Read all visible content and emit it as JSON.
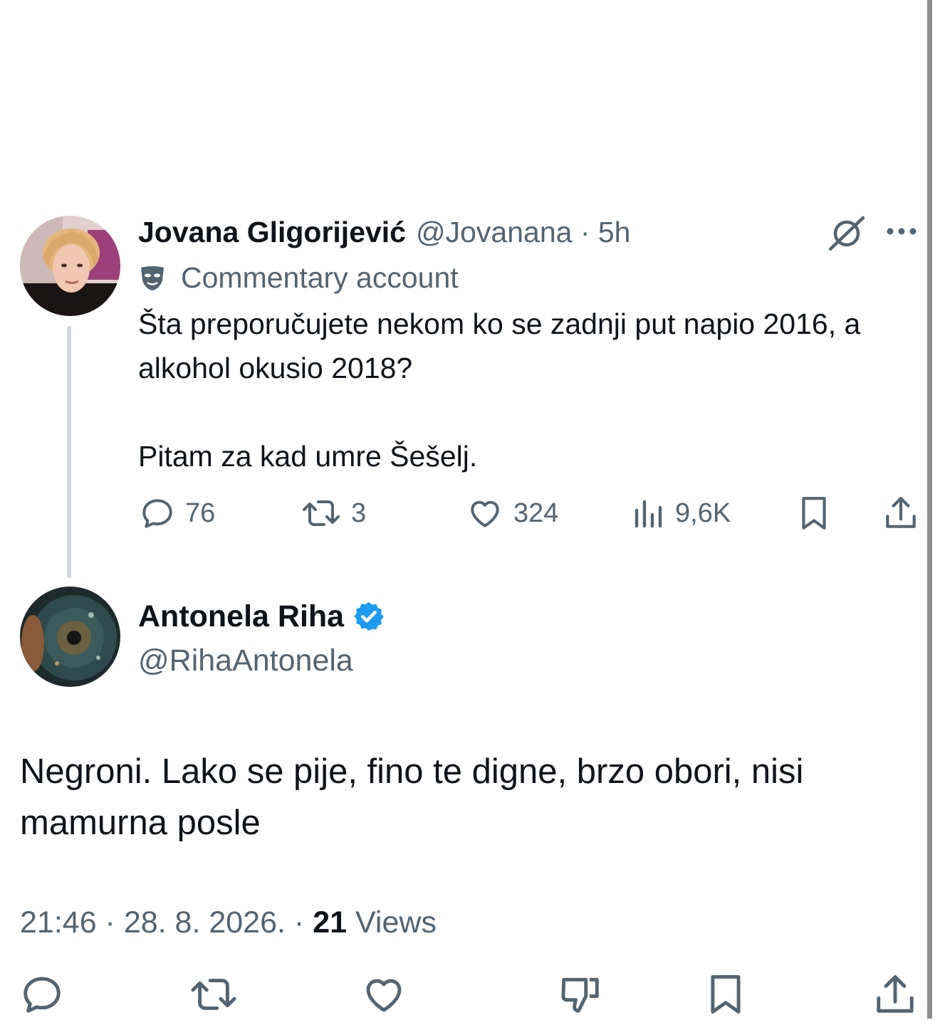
{
  "parent_tweet": {
    "author_name": "Jovana Gligorijević",
    "meta": "@Jovanana · 5h",
    "badge_label": "Commentary account",
    "text_line1": "Šta preporučujete nekom ko se zadnji put napio 2016, a alkohol okusio 2018?",
    "text_line2": "Pitam za kad umre Šešelj.",
    "actions": {
      "replies": "76",
      "reposts": "3",
      "likes": "324",
      "views": "9,6K"
    },
    "icons": [
      "grok-icon",
      "more-icon",
      "commentary-mask-icon",
      "reply-icon",
      "retweet-icon",
      "like-icon",
      "views-icon",
      "bookmark-icon",
      "share-icon"
    ]
  },
  "main_tweet": {
    "author_name": "Antonela Riha",
    "handle": "@RihaAntonela",
    "verified": true,
    "text": "Negroni. Lako se pije, fino te digne, brzo obori, nisi mamurna posle",
    "timestamp": "21:46 · 28. 8. 2026. ·",
    "views_count": "21",
    "views_label": "Views",
    "icons": [
      "verified-badge-icon",
      "reply-icon",
      "retweet-icon",
      "like-icon",
      "dislike-icon",
      "bookmark-icon",
      "share-icon"
    ]
  },
  "colors": {
    "text_primary": "#0f1419",
    "text_secondary": "#536471",
    "verified_blue": "#1d9bf0",
    "thread_line": "#cfd9de",
    "background": "#ffffff"
  }
}
